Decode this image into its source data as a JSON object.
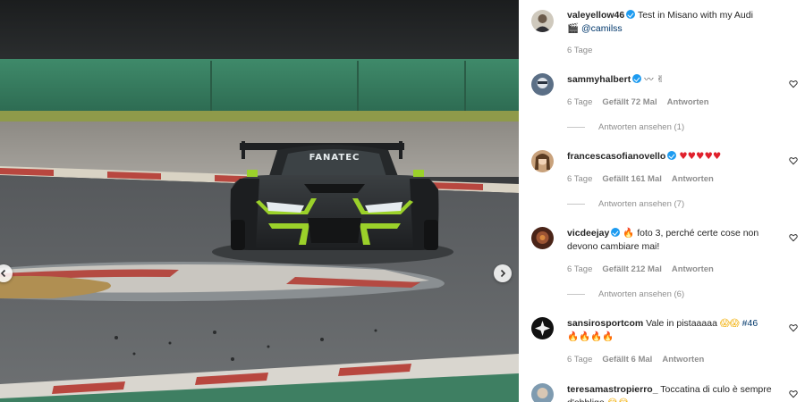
{
  "post": {
    "author": "valeyellow46",
    "caption": "Test in Misano with my Audi",
    "mention": "@camilss",
    "time": "6 Tage"
  },
  "photo": {
    "car_livery_text": "FANATEC"
  },
  "comments": [
    {
      "user": "sammyhalbert",
      "verified": true,
      "text": "〰 ✌",
      "time": "6 Tage",
      "likes": "Gefällt 72 Mal",
      "reply": "Antworten",
      "view_replies": "Antworten ansehen (1)"
    },
    {
      "user": "francescasofianovello",
      "verified": true,
      "text": "♥♥♥♥♥",
      "time": "6 Tage",
      "likes": "Gefällt 161 Mal",
      "reply": "Antworten",
      "view_replies": "Antworten ansehen (7)"
    },
    {
      "user": "vicdeejay",
      "verified": true,
      "emoji": "🔥",
      "text": "foto 3, perché certe cose non devono cambiare mai!",
      "time": "6 Tage",
      "likes": "Gefällt 212 Mal",
      "reply": "Antworten",
      "view_replies": "Antworten ansehen (6)"
    },
    {
      "user": "sansirosportcom",
      "verified": false,
      "text": "Vale in pistaaaaa",
      "emoji_a": "😱😱",
      "hashtag": "#46",
      "emoji_b": "🔥🔥🔥🔥",
      "time": "6 Tage",
      "likes": "Gefällt 6 Mal",
      "reply": "Antworten"
    },
    {
      "user": "teresamastropierro_",
      "verified": false,
      "text": "Toccatina di culo è sempre d'obbligo",
      "emoji": "😂😂"
    }
  ],
  "colors": {
    "verified": "#1d9bf0",
    "meta_grey": "#8e8e8e",
    "hashtag": "#00376b",
    "car_accent": "#9bd12a"
  },
  "icons": {
    "nav_prev": "chevron-left-icon",
    "nav_next": "chevron-right-icon",
    "like": "heart-outline-icon"
  }
}
